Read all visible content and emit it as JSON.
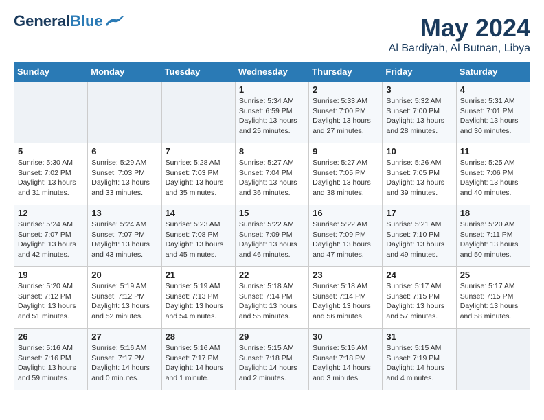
{
  "header": {
    "logo_general": "General",
    "logo_blue": "Blue",
    "month": "May 2024",
    "location": "Al Bardiyah, Al Butnan, Libya"
  },
  "days_of_week": [
    "Sunday",
    "Monday",
    "Tuesday",
    "Wednesday",
    "Thursday",
    "Friday",
    "Saturday"
  ],
  "weeks": [
    [
      {
        "day": "",
        "content": ""
      },
      {
        "day": "",
        "content": ""
      },
      {
        "day": "",
        "content": ""
      },
      {
        "day": "1",
        "content": "Sunrise: 5:34 AM\nSunset: 6:59 PM\nDaylight: 13 hours\nand 25 minutes."
      },
      {
        "day": "2",
        "content": "Sunrise: 5:33 AM\nSunset: 7:00 PM\nDaylight: 13 hours\nand 27 minutes."
      },
      {
        "day": "3",
        "content": "Sunrise: 5:32 AM\nSunset: 7:00 PM\nDaylight: 13 hours\nand 28 minutes."
      },
      {
        "day": "4",
        "content": "Sunrise: 5:31 AM\nSunset: 7:01 PM\nDaylight: 13 hours\nand 30 minutes."
      }
    ],
    [
      {
        "day": "5",
        "content": "Sunrise: 5:30 AM\nSunset: 7:02 PM\nDaylight: 13 hours\nand 31 minutes."
      },
      {
        "day": "6",
        "content": "Sunrise: 5:29 AM\nSunset: 7:03 PM\nDaylight: 13 hours\nand 33 minutes."
      },
      {
        "day": "7",
        "content": "Sunrise: 5:28 AM\nSunset: 7:03 PM\nDaylight: 13 hours\nand 35 minutes."
      },
      {
        "day": "8",
        "content": "Sunrise: 5:27 AM\nSunset: 7:04 PM\nDaylight: 13 hours\nand 36 minutes."
      },
      {
        "day": "9",
        "content": "Sunrise: 5:27 AM\nSunset: 7:05 PM\nDaylight: 13 hours\nand 38 minutes."
      },
      {
        "day": "10",
        "content": "Sunrise: 5:26 AM\nSunset: 7:05 PM\nDaylight: 13 hours\nand 39 minutes."
      },
      {
        "day": "11",
        "content": "Sunrise: 5:25 AM\nSunset: 7:06 PM\nDaylight: 13 hours\nand 40 minutes."
      }
    ],
    [
      {
        "day": "12",
        "content": "Sunrise: 5:24 AM\nSunset: 7:07 PM\nDaylight: 13 hours\nand 42 minutes."
      },
      {
        "day": "13",
        "content": "Sunrise: 5:24 AM\nSunset: 7:07 PM\nDaylight: 13 hours\nand 43 minutes."
      },
      {
        "day": "14",
        "content": "Sunrise: 5:23 AM\nSunset: 7:08 PM\nDaylight: 13 hours\nand 45 minutes."
      },
      {
        "day": "15",
        "content": "Sunrise: 5:22 AM\nSunset: 7:09 PM\nDaylight: 13 hours\nand 46 minutes."
      },
      {
        "day": "16",
        "content": "Sunrise: 5:22 AM\nSunset: 7:09 PM\nDaylight: 13 hours\nand 47 minutes."
      },
      {
        "day": "17",
        "content": "Sunrise: 5:21 AM\nSunset: 7:10 PM\nDaylight: 13 hours\nand 49 minutes."
      },
      {
        "day": "18",
        "content": "Sunrise: 5:20 AM\nSunset: 7:11 PM\nDaylight: 13 hours\nand 50 minutes."
      }
    ],
    [
      {
        "day": "19",
        "content": "Sunrise: 5:20 AM\nSunset: 7:12 PM\nDaylight: 13 hours\nand 51 minutes."
      },
      {
        "day": "20",
        "content": "Sunrise: 5:19 AM\nSunset: 7:12 PM\nDaylight: 13 hours\nand 52 minutes."
      },
      {
        "day": "21",
        "content": "Sunrise: 5:19 AM\nSunset: 7:13 PM\nDaylight: 13 hours\nand 54 minutes."
      },
      {
        "day": "22",
        "content": "Sunrise: 5:18 AM\nSunset: 7:14 PM\nDaylight: 13 hours\nand 55 minutes."
      },
      {
        "day": "23",
        "content": "Sunrise: 5:18 AM\nSunset: 7:14 PM\nDaylight: 13 hours\nand 56 minutes."
      },
      {
        "day": "24",
        "content": "Sunrise: 5:17 AM\nSunset: 7:15 PM\nDaylight: 13 hours\nand 57 minutes."
      },
      {
        "day": "25",
        "content": "Sunrise: 5:17 AM\nSunset: 7:15 PM\nDaylight: 13 hours\nand 58 minutes."
      }
    ],
    [
      {
        "day": "26",
        "content": "Sunrise: 5:16 AM\nSunset: 7:16 PM\nDaylight: 13 hours\nand 59 minutes."
      },
      {
        "day": "27",
        "content": "Sunrise: 5:16 AM\nSunset: 7:17 PM\nDaylight: 14 hours\nand 0 minutes."
      },
      {
        "day": "28",
        "content": "Sunrise: 5:16 AM\nSunset: 7:17 PM\nDaylight: 14 hours\nand 1 minute."
      },
      {
        "day": "29",
        "content": "Sunrise: 5:15 AM\nSunset: 7:18 PM\nDaylight: 14 hours\nand 2 minutes."
      },
      {
        "day": "30",
        "content": "Sunrise: 5:15 AM\nSunset: 7:18 PM\nDaylight: 14 hours\nand 3 minutes."
      },
      {
        "day": "31",
        "content": "Sunrise: 5:15 AM\nSunset: 7:19 PM\nDaylight: 14 hours\nand 4 minutes."
      },
      {
        "day": "",
        "content": ""
      }
    ]
  ]
}
